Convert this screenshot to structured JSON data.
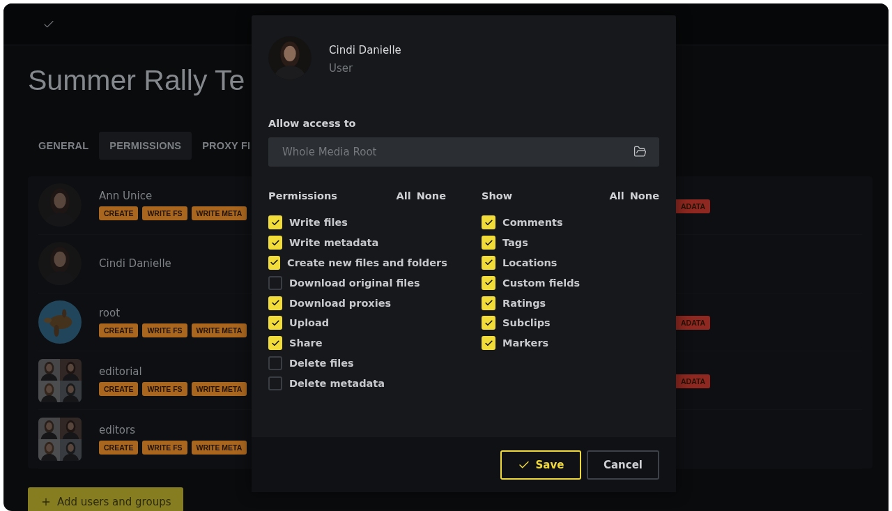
{
  "page": {
    "title": "Summer Rally Te",
    "tabs": [
      {
        "label": "GENERAL",
        "selected": false
      },
      {
        "label": "PERMISSIONS",
        "selected": true
      },
      {
        "label": "PROXY FI",
        "selected": false
      }
    ],
    "members": [
      {
        "name": "Ann Unice",
        "chips": [
          {
            "label": "CREATE",
            "color": "#a8661f"
          },
          {
            "label": "WRITE FS",
            "color": "#a8661f"
          },
          {
            "label": "WRITE META",
            "color": "#a8661f"
          }
        ],
        "trailing_chip": {
          "label": "ADATA",
          "color": "#8e2820"
        }
      },
      {
        "name": "Cindi Danielle"
      },
      {
        "name": "root",
        "chips": [
          {
            "label": "CREATE",
            "color": "#a8661f"
          },
          {
            "label": "WRITE FS",
            "color": "#a8661f"
          },
          {
            "label": "WRITE META",
            "color": "#a8661f"
          }
        ],
        "trailing_chip": {
          "label": "ADATA",
          "color": "#8e2820"
        }
      },
      {
        "name": "editorial",
        "chips": [
          {
            "label": "CREATE",
            "color": "#a8661f"
          },
          {
            "label": "WRITE FS",
            "color": "#a8661f"
          },
          {
            "label": "WRITE META",
            "color": "#a8661f"
          }
        ],
        "trailing_chip": {
          "label": "ADATA",
          "color": "#8e2820"
        }
      },
      {
        "name": "editors",
        "chips": [
          {
            "label": "CREATE",
            "color": "#a8661f"
          },
          {
            "label": "WRITE FS",
            "color": "#a8661f"
          },
          {
            "label": "WRITE META",
            "color": "#a8661f"
          }
        ]
      }
    ],
    "add_button": "Add users and groups"
  },
  "dialog": {
    "user": {
      "name": "Cindi Danielle",
      "role": "User"
    },
    "access": {
      "label": "Allow access to",
      "placeholder": "Whole Media Root"
    },
    "groups": [
      {
        "title": "Permissions",
        "all": "All",
        "none": "None",
        "items": [
          {
            "label": "Write files",
            "checked": true
          },
          {
            "label": "Write metadata",
            "checked": true
          },
          {
            "label": "Create new files and folders",
            "checked": true
          },
          {
            "label": "Download original files",
            "checked": false
          },
          {
            "label": "Download proxies",
            "checked": true
          },
          {
            "label": "Upload",
            "checked": true
          },
          {
            "label": "Share",
            "checked": true
          },
          {
            "label": "Delete files",
            "checked": false
          },
          {
            "label": "Delete metadata",
            "checked": false
          }
        ]
      },
      {
        "title": "Show",
        "all": "All",
        "none": "None",
        "items": [
          {
            "label": "Comments",
            "checked": true
          },
          {
            "label": "Tags",
            "checked": true
          },
          {
            "label": "Locations",
            "checked": true
          },
          {
            "label": "Custom fields",
            "checked": true
          },
          {
            "label": "Ratings",
            "checked": true
          },
          {
            "label": "Subclips",
            "checked": true
          },
          {
            "label": "Markers",
            "checked": true
          }
        ]
      }
    ],
    "save": "Save",
    "cancel": "Cancel"
  }
}
